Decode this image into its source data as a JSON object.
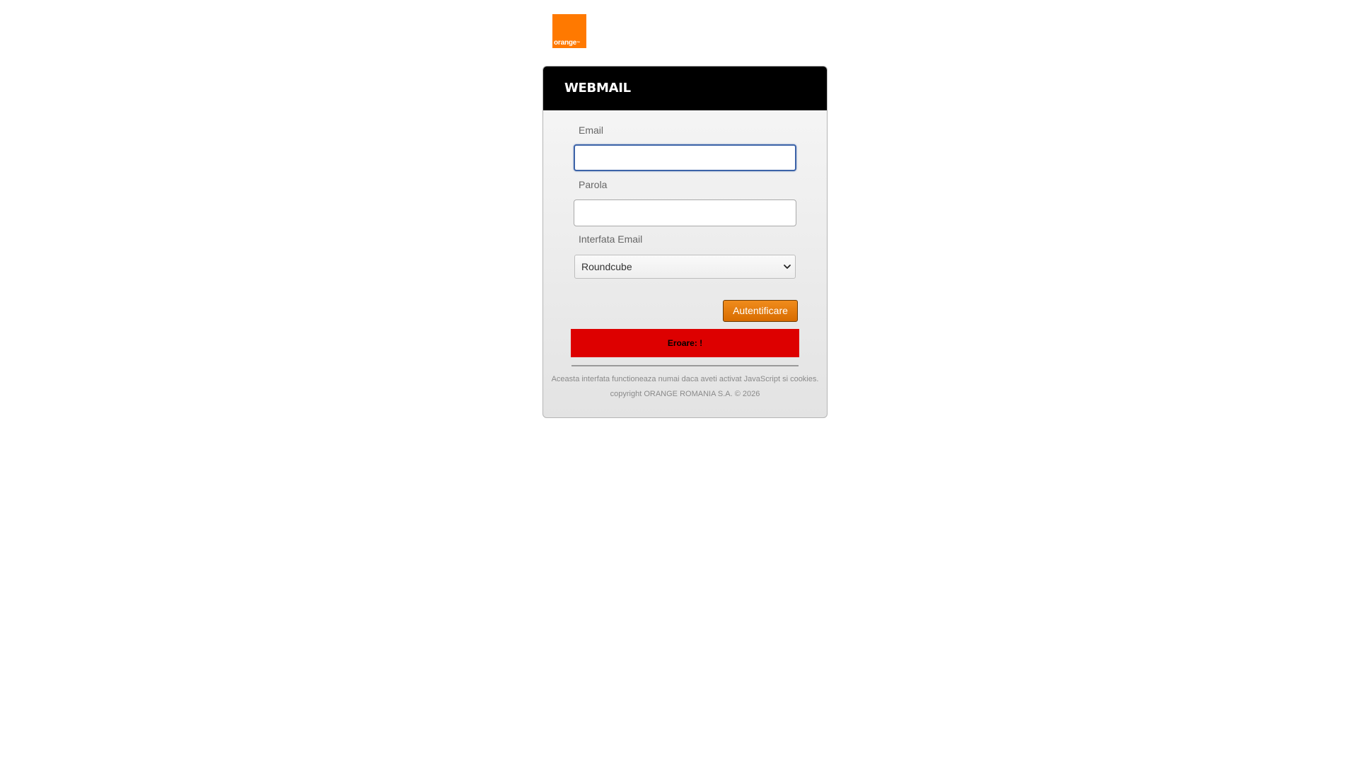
{
  "brand": {
    "logo_text": "orange",
    "logo_trademark": "™",
    "logo_color": "#ff7900"
  },
  "panel": {
    "title": "WEBMAIL"
  },
  "form": {
    "email_label": "Email",
    "email_value": "",
    "password_label": "Parola",
    "password_value": "",
    "interface_label": "Interfata Email",
    "interface_selected": "Roundcube",
    "submit_label": "Autentificare"
  },
  "error": {
    "message": "Eroare: !",
    "color": "#dd0000"
  },
  "footer": {
    "notice": "Aceasta interfata functioneaza numai daca aveti activat JavaScript si cookies.",
    "copyright": "copyright ORANGE ROMANIA S.A. © 2026"
  },
  "colors": {
    "header_bg": "#000000",
    "button_accent": "#e87b0c",
    "focus_border": "#3c63a8"
  },
  "icons": {
    "select_arrow": "chevron-down-icon"
  }
}
